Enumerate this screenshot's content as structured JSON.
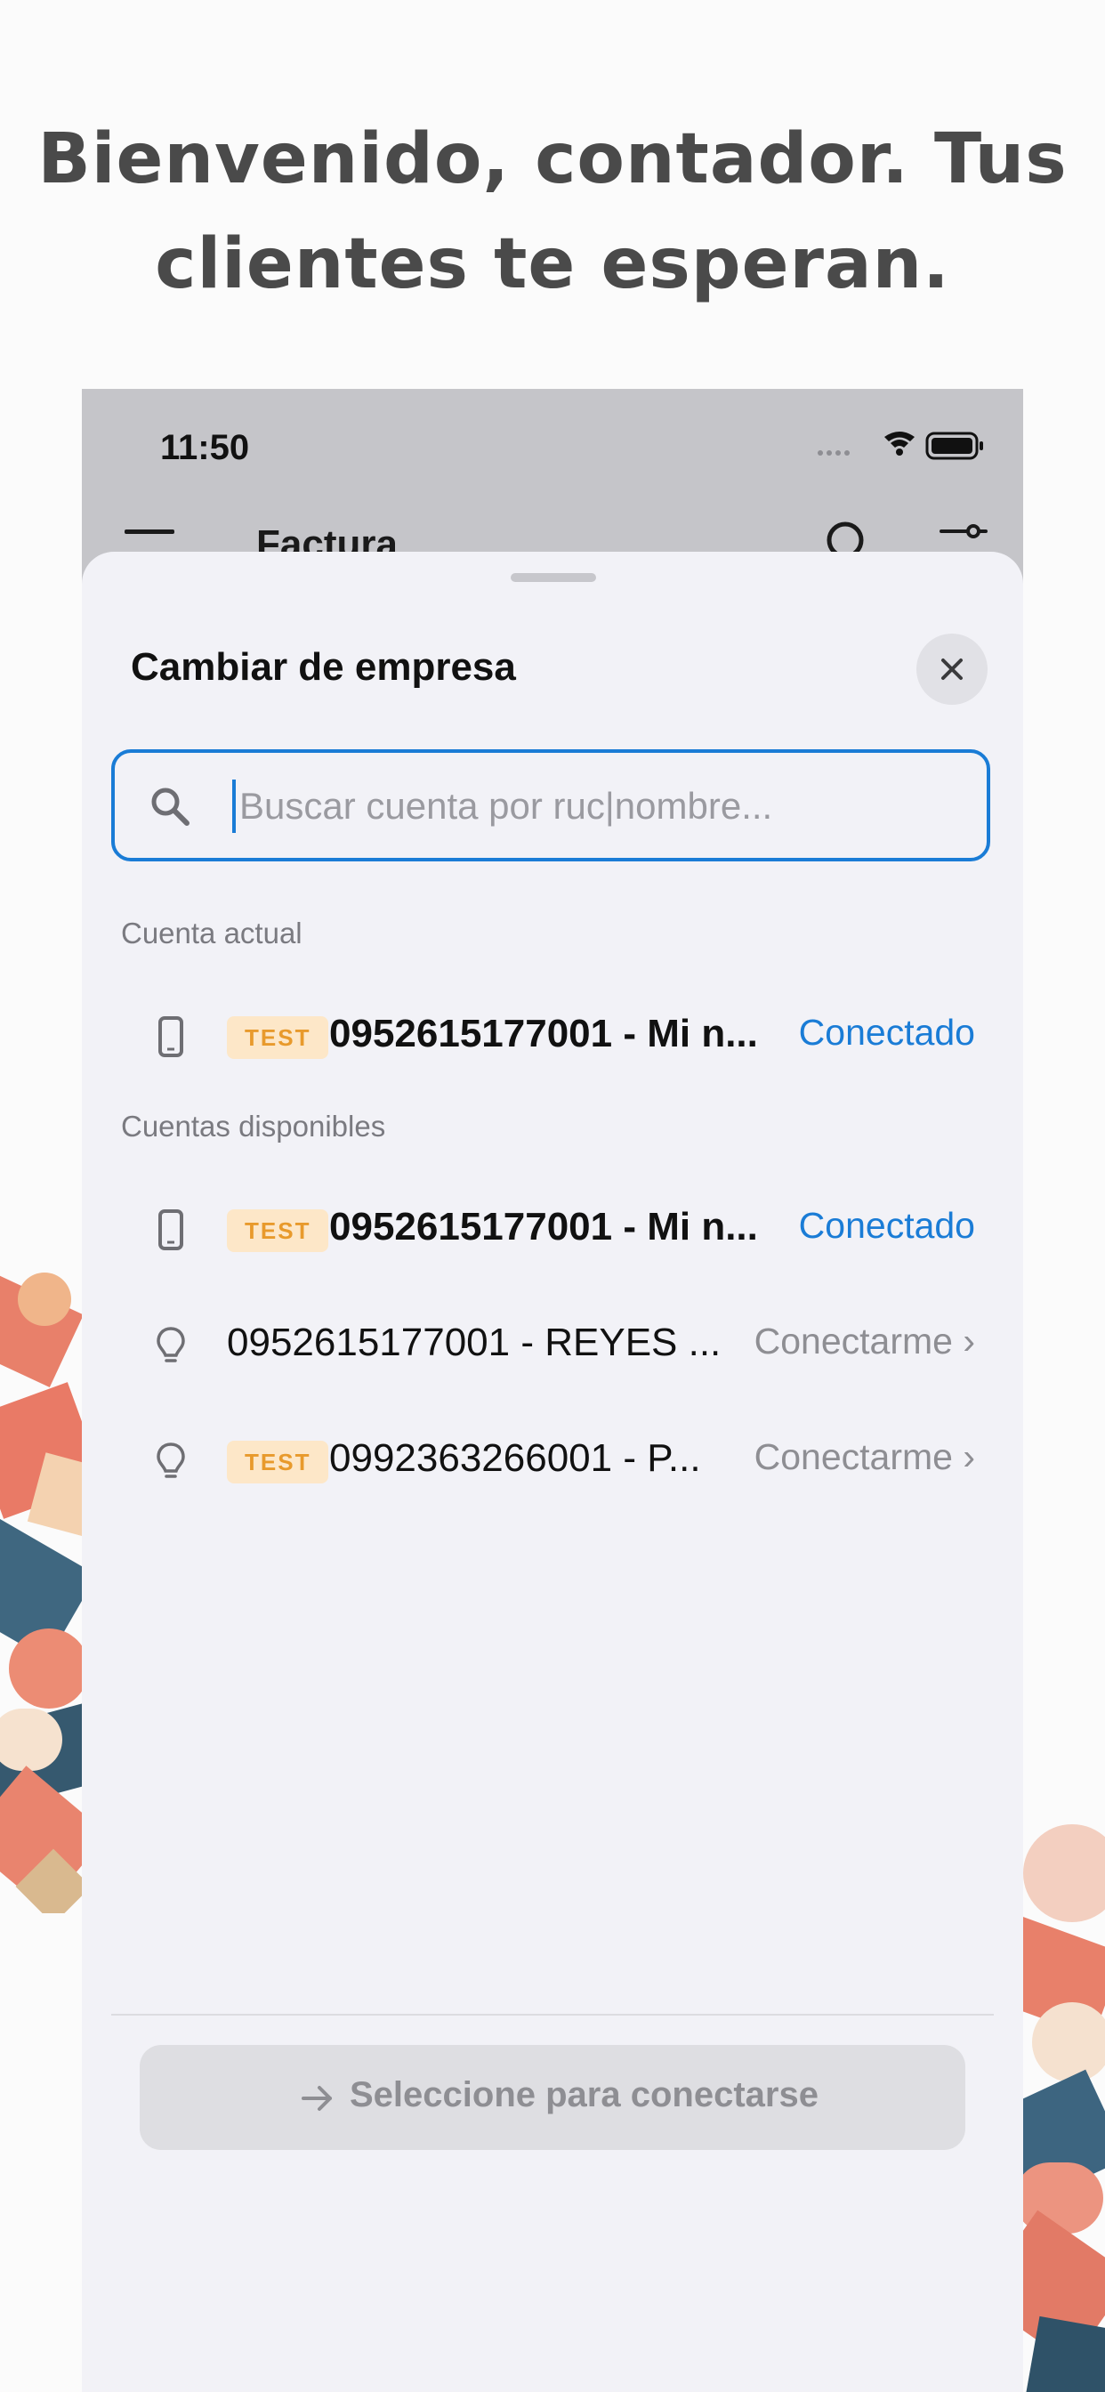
{
  "promo": {
    "headline_line1": "Bienvenido, contador. Tus",
    "headline_line2": "clientes te esperan."
  },
  "status_bar": {
    "time": "11:50"
  },
  "app_header": {
    "title": "Factura"
  },
  "sheet": {
    "title": "Cambiar de empresa",
    "search": {
      "value": "",
      "placeholder": "Buscar cuenta por ruc|nombre..."
    },
    "current_section_label": "Cuenta actual",
    "current_account": {
      "badge": "TEST",
      "name": "0952615177001 - Mi n...",
      "status": "Conectado",
      "icon": "phone-icon"
    },
    "available_section_label": "Cuentas disponibles",
    "available_accounts": [
      {
        "badge": "TEST",
        "name": "0952615177001 - Mi n...",
        "status": "Conectado",
        "icon": "phone-icon"
      },
      {
        "badge": "",
        "name": "0952615177001 - REYES ...",
        "status": "Conectarme",
        "icon": "lightbulb-icon"
      },
      {
        "badge": "TEST",
        "name": "0992363266001 - P...",
        "status": "Conectarme",
        "icon": "lightbulb-icon"
      }
    ],
    "connect_button_label": "Seleccione para conectarse"
  },
  "colors": {
    "accent": "#1a7cd6",
    "badge_bg": "#fde7c8",
    "badge_text": "#e89a2c",
    "sheet_bg": "#f2f2f7"
  }
}
